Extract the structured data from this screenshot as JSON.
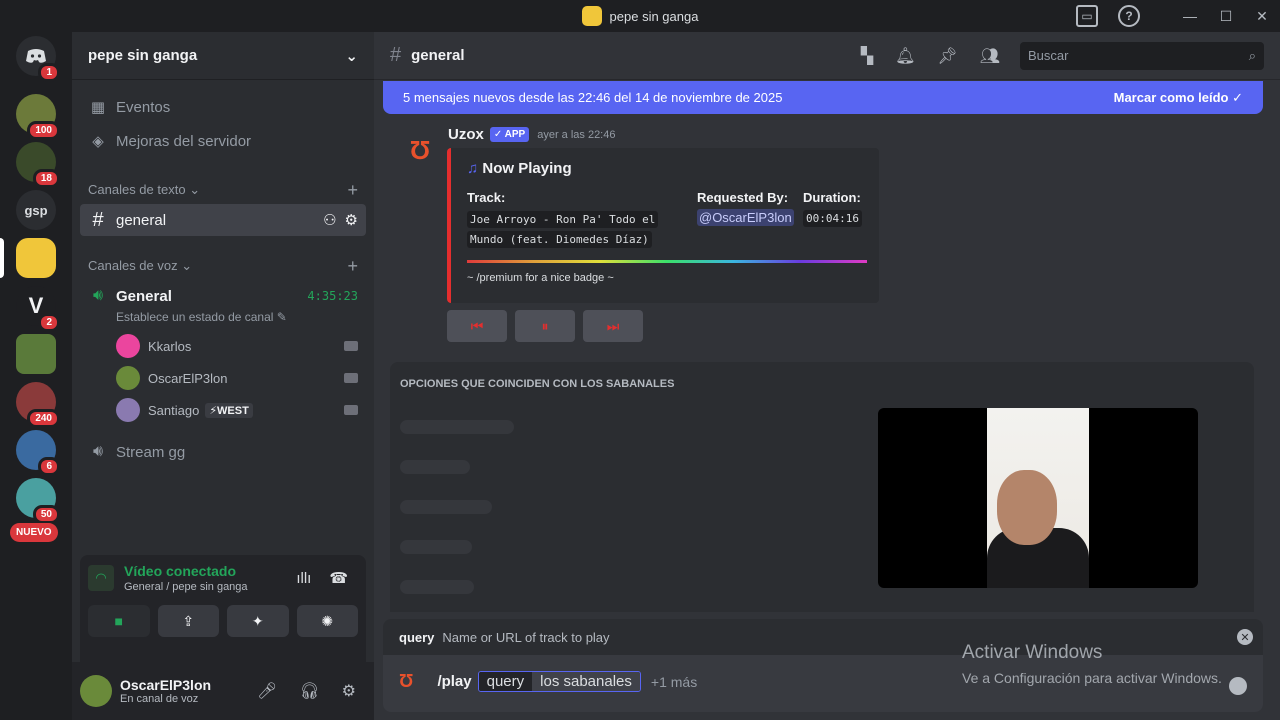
{
  "window": {
    "title": "pepe sin ganga",
    "min": "—",
    "max": "☐",
    "close": "✕"
  },
  "guilds": [
    {
      "id": "home",
      "label": "",
      "badge": "1",
      "color": "#5865f2"
    },
    {
      "id": "g1",
      "label": "",
      "badge": "100",
      "color": "#6c7a3a"
    },
    {
      "id": "g2",
      "label": "",
      "badge": "18",
      "color": "#3a4a2a"
    },
    {
      "id": "gsp",
      "label": "gsp",
      "badge": "",
      "color": "#2b2d31"
    },
    {
      "id": "g4",
      "label": "",
      "badge": "",
      "color": "#f0c63a"
    },
    {
      "id": "g5",
      "label": "V",
      "badge": "2",
      "color": "#1e1f22"
    },
    {
      "id": "g6",
      "label": "",
      "badge": "",
      "color": "#5a7a3a"
    },
    {
      "id": "g7",
      "label": "",
      "badge": "240",
      "color": "#8a3a3a"
    },
    {
      "id": "g8",
      "label": "",
      "badge": "6",
      "color": "#3a6aa0"
    },
    {
      "id": "g9",
      "label": "",
      "badge": "50",
      "color": "#4aa0a0"
    }
  ],
  "nuevo_label": "NUEVO",
  "server": {
    "name": "pepe sin ganga",
    "events": "Eventos",
    "boosts": "Mejoras del servidor",
    "text_category": "Canales de texto",
    "voice_category": "Canales de voz",
    "text_channel": "general",
    "voice_channel": "General",
    "voice_timer": "4:35:23",
    "voice_status": "Establece un estado de canal",
    "voice_users": [
      {
        "name": "Kkarlos",
        "tag": ""
      },
      {
        "name": "OscarElP3lon",
        "tag": ""
      },
      {
        "name": "Santiago",
        "tag": "⚡WEST"
      }
    ],
    "stream_channel": "Stream gg"
  },
  "voice_panel": {
    "status": "Vídeo conectado",
    "location": "General / pepe sin ganga"
  },
  "user": {
    "name": "OscarElP3lon",
    "status": "En canal de voz"
  },
  "channel_header": {
    "name": "general",
    "search_placeholder": "Buscar"
  },
  "new_messages": {
    "text": "5 mensajes nuevos desde las 22:46 del 14 de noviembre de 2025",
    "action": "Marcar como leído"
  },
  "message": {
    "author": "Uzox",
    "app_tag": "✓ APP",
    "timestamp": "ayer a las 22:46",
    "embed": {
      "title": "Now Playing",
      "track_label": "Track:",
      "track_line1": "Joe Arroyo - Ron Pa' Todo el",
      "track_line2": "Mundo (feat. Diomedes Díaz)",
      "requested_label": "Requested By:",
      "requested_by": "@OscarElP3lon",
      "duration_label": "Duration:",
      "duration": "00:04:16",
      "footer": "~ /premium for a nice badge ~"
    }
  },
  "autocomplete": {
    "header": "OPCIONES QUE COINCIDEN CON LOS SABANALES"
  },
  "command_input": {
    "option_name": "query",
    "option_desc": "Name or URL of track to play",
    "command": "/play",
    "key": "query",
    "value": "los sabanales",
    "more": "+1 más"
  },
  "watermark": {
    "line1": "Activar Windows",
    "line2": "Ve a Configuración para activar Windows."
  }
}
